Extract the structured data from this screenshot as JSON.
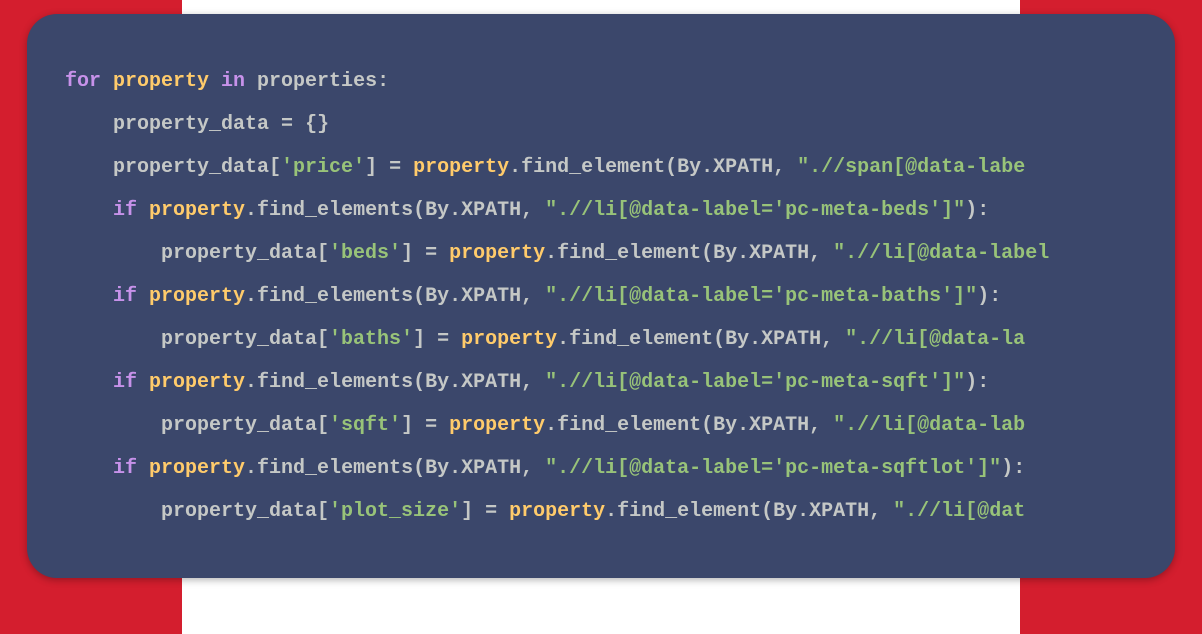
{
  "code": {
    "lines": [
      {
        "indent": 0,
        "tokens": [
          {
            "t": "for ",
            "c": "kw-for"
          },
          {
            "t": "property",
            "c": "var-property"
          },
          {
            "t": " in ",
            "c": "kw-in"
          },
          {
            "t": "properties",
            "c": "var-name"
          },
          {
            "t": ":",
            "c": "punct"
          }
        ]
      },
      {
        "indent": 1,
        "tokens": [
          {
            "t": "property_data ",
            "c": "var-name"
          },
          {
            "t": "= ",
            "c": "eq"
          },
          {
            "t": "{}",
            "c": "punct"
          }
        ]
      },
      {
        "indent": 1,
        "tokens": [
          {
            "t": "property_data[",
            "c": "var-name"
          },
          {
            "t": "'price'",
            "c": "str-green"
          },
          {
            "t": "] ",
            "c": "punct"
          },
          {
            "t": "= ",
            "c": "eq"
          },
          {
            "t": "property",
            "c": "var-property"
          },
          {
            "t": ".find_element(By.XPATH, ",
            "c": "method"
          },
          {
            "t": "\".//span[@data-labe",
            "c": "str-green"
          }
        ]
      },
      {
        "indent": 1,
        "tokens": [
          {
            "t": "if ",
            "c": "kw-if"
          },
          {
            "t": "property",
            "c": "var-property"
          },
          {
            "t": ".find_elements(By.XPATH, ",
            "c": "method"
          },
          {
            "t": "\".//li[@data-label='pc-meta-beds']\"",
            "c": "str-green"
          },
          {
            "t": "):",
            "c": "punct"
          }
        ]
      },
      {
        "indent": 2,
        "tokens": [
          {
            "t": "property_data[",
            "c": "var-name"
          },
          {
            "t": "'beds'",
            "c": "str-green"
          },
          {
            "t": "] ",
            "c": "punct"
          },
          {
            "t": "= ",
            "c": "eq"
          },
          {
            "t": "property",
            "c": "var-property"
          },
          {
            "t": ".find_element(By.XPATH, ",
            "c": "method"
          },
          {
            "t": "\".//li[@data-label",
            "c": "str-green"
          }
        ]
      },
      {
        "indent": 1,
        "tokens": [
          {
            "t": "if ",
            "c": "kw-if"
          },
          {
            "t": "property",
            "c": "var-property"
          },
          {
            "t": ".find_elements(By.XPATH, ",
            "c": "method"
          },
          {
            "t": "\".//li[@data-label='pc-meta-baths']\"",
            "c": "str-green"
          },
          {
            "t": "):",
            "c": "punct"
          }
        ]
      },
      {
        "indent": 2,
        "tokens": [
          {
            "t": "property_data[",
            "c": "var-name"
          },
          {
            "t": "'baths'",
            "c": "str-green"
          },
          {
            "t": "] ",
            "c": "punct"
          },
          {
            "t": "= ",
            "c": "eq"
          },
          {
            "t": "property",
            "c": "var-property"
          },
          {
            "t": ".find_element(By.XPATH, ",
            "c": "method"
          },
          {
            "t": "\".//li[@data-la",
            "c": "str-green"
          }
        ]
      },
      {
        "indent": 1,
        "tokens": [
          {
            "t": "if ",
            "c": "kw-if"
          },
          {
            "t": "property",
            "c": "var-property"
          },
          {
            "t": ".find_elements(By.XPATH, ",
            "c": "method"
          },
          {
            "t": "\".//li[@data-label='pc-meta-sqft']\"",
            "c": "str-green"
          },
          {
            "t": "):",
            "c": "punct"
          }
        ]
      },
      {
        "indent": 2,
        "tokens": [
          {
            "t": "property_data[",
            "c": "var-name"
          },
          {
            "t": "'sqft'",
            "c": "str-green"
          },
          {
            "t": "] ",
            "c": "punct"
          },
          {
            "t": "= ",
            "c": "eq"
          },
          {
            "t": "property",
            "c": "var-property"
          },
          {
            "t": ".find_element(By.XPATH, ",
            "c": "method"
          },
          {
            "t": "\".//li[@data-lab",
            "c": "str-green"
          }
        ]
      },
      {
        "indent": 1,
        "tokens": [
          {
            "t": "if ",
            "c": "kw-if"
          },
          {
            "t": "property",
            "c": "var-property"
          },
          {
            "t": ".find_elements(By.XPATH, ",
            "c": "method"
          },
          {
            "t": "\".//li[@data-label='pc-meta-sqftlot']\"",
            "c": "str-green"
          },
          {
            "t": "):",
            "c": "punct"
          }
        ]
      },
      {
        "indent": 2,
        "tokens": [
          {
            "t": "property_data[",
            "c": "var-name"
          },
          {
            "t": "'plot_size'",
            "c": "str-green"
          },
          {
            "t": "] ",
            "c": "punct"
          },
          {
            "t": "= ",
            "c": "eq"
          },
          {
            "t": "property",
            "c": "var-property"
          },
          {
            "t": ".find_element(By.XPATH, ",
            "c": "method"
          },
          {
            "t": "\".//li[@dat",
            "c": "str-green"
          }
        ]
      }
    ]
  }
}
